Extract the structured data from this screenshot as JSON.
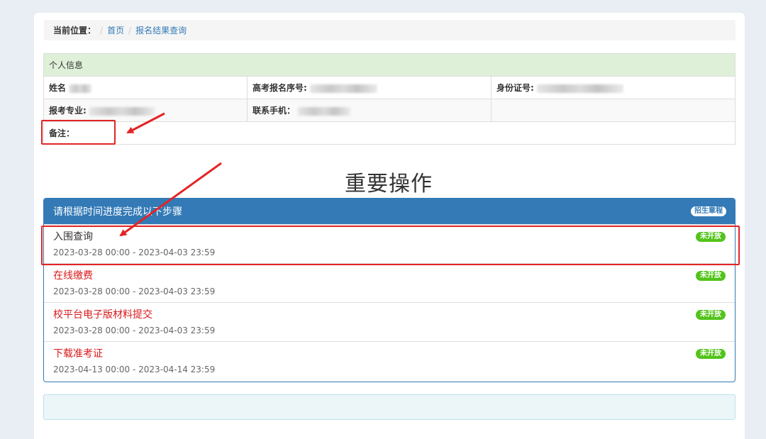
{
  "breadcrumb": {
    "label": "当前位置：",
    "sep1": "/",
    "home": "首页",
    "sep2": "/",
    "current": "报名结果查询"
  },
  "info": {
    "header": "个人信息",
    "name_label": "姓名",
    "gaokao_label": "高考报名序号:",
    "id_label": "身份证号:",
    "major_label": "报考专业:",
    "phone_label": "联系手机：",
    "remark_label": "备注："
  },
  "section_title": "重要操作",
  "panel": {
    "heading": "请根据时间进度完成以下步骤",
    "badge": "招生章程"
  },
  "steps": [
    {
      "name": "入围查询",
      "time": "2023-03-28 00:00 - 2023-04-03 23:59",
      "status": "未开放"
    },
    {
      "name": "在线缴费",
      "time": "2023-03-28 00:00 - 2023-04-03 23:59",
      "status": "未开放"
    },
    {
      "name": "校平台电子版材料提交",
      "time": "2023-03-28 00:00 - 2023-04-03 23:59",
      "status": "未开放"
    },
    {
      "name": "下载准考证",
      "time": "2023-04-13 00:00 - 2023-04-14 23:59",
      "status": "未开放"
    }
  ],
  "colors": {
    "primary": "#337ab7",
    "success_header": "#dff0d8",
    "status_green": "#52c41a",
    "step_red": "#d9181b",
    "annotation_red": "#e32424"
  }
}
